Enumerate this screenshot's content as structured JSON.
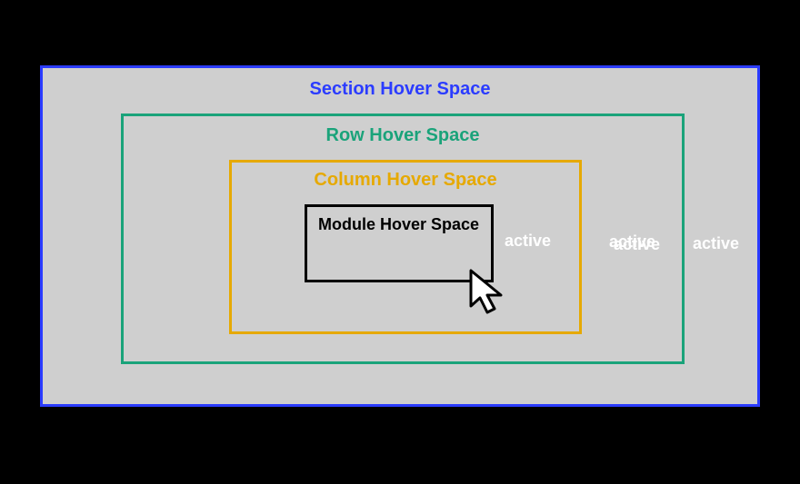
{
  "section": {
    "label": "Section Hover Space",
    "active": "active",
    "color": "#2b3cff"
  },
  "row": {
    "label": "Row Hover Space",
    "active": "active",
    "color": "#1aa37a"
  },
  "column": {
    "label": "Column Hover Space",
    "active": "active",
    "color": "#e6a900"
  },
  "module": {
    "label": "Module Hover Space",
    "active": "active",
    "color": "#000000"
  }
}
